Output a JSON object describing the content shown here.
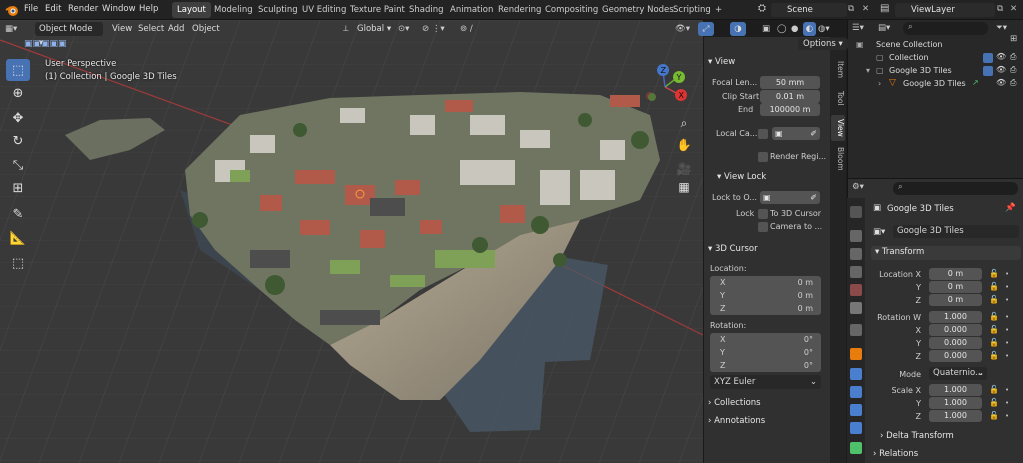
{
  "menu": [
    "File",
    "Edit",
    "Render",
    "Window",
    "Help"
  ],
  "workspaces": [
    "Layout",
    "Modeling",
    "Sculpting",
    "UV Editing",
    "Texture Paint",
    "Shading",
    "Animation",
    "Rendering",
    "Compositing",
    "Geometry Nodes",
    "Scripting"
  ],
  "add_workspace": "+",
  "scene": "Scene",
  "view_layer": "ViewLayer",
  "viewport": {
    "mode": "Object Mode",
    "menus": [
      "View",
      "Select",
      "Add",
      "Object"
    ],
    "transform_orientation": "Global",
    "options": "Options",
    "overlay_title": "User Perspective",
    "overlay_sub": "(1) Collection | Google 3D Tiles",
    "gizmo": {
      "x": "X",
      "y": "Y",
      "z": "Z"
    }
  },
  "npanel": {
    "tabs": [
      "Item",
      "Tool",
      "View",
      "Bloom"
    ],
    "view_section": "View",
    "focal_label": "Focal Len...",
    "focal_value": "50 mm",
    "clip_label": "Clip Start",
    "clip_value": "0.01 m",
    "end_label": "End",
    "end_value": "100000 m",
    "local_camera": "Local Ca...",
    "render_region": "Render Regi...",
    "view_lock": "View Lock",
    "lock_to_object": "Lock to O...",
    "lock": "Lock",
    "to_3d_cursor": "To 3D Cursor",
    "camera_to": "Camera to ...",
    "cursor_section": "3D Cursor",
    "location": "Location:",
    "rotation": "Rotation:",
    "cursor_loc": [
      {
        "axis": "X",
        "value": "0 m"
      },
      {
        "axis": "Y",
        "value": "0 m"
      },
      {
        "axis": "Z",
        "value": "0 m"
      }
    ],
    "cursor_rot": [
      {
        "axis": "X",
        "value": "0°"
      },
      {
        "axis": "Y",
        "value": "0°"
      },
      {
        "axis": "Z",
        "value": "0°"
      }
    ],
    "euler": "XYZ Euler",
    "collections": "Collections",
    "annotations": "Annotations"
  },
  "outliner": {
    "root": "Scene Collection",
    "collection": "Collection",
    "object": "Google 3D Tiles",
    "mesh": "Google 3D Tiles"
  },
  "properties": {
    "object_name": "Google 3D Tiles",
    "data_name": "Google 3D Tiles",
    "transform": "Transform",
    "location_label": "Location X",
    "location": [
      {
        "axis": "Location X",
        "value": "0 m"
      },
      {
        "axis": "Y",
        "value": "0 m"
      },
      {
        "axis": "Z",
        "value": "0 m"
      }
    ],
    "rotation": [
      {
        "axis": "Rotation W",
        "value": "1.000"
      },
      {
        "axis": "X",
        "value": "0.000"
      },
      {
        "axis": "Y",
        "value": "0.000"
      },
      {
        "axis": "Z",
        "value": "0.000"
      }
    ],
    "mode_label": "Mode",
    "mode_value": "Quaternio...",
    "scale": [
      {
        "axis": "Scale X",
        "value": "1.000"
      },
      {
        "axis": "Y",
        "value": "1.000"
      },
      {
        "axis": "Z",
        "value": "1.000"
      }
    ],
    "delta_transform": "Delta Transform",
    "relations": "Relations"
  }
}
